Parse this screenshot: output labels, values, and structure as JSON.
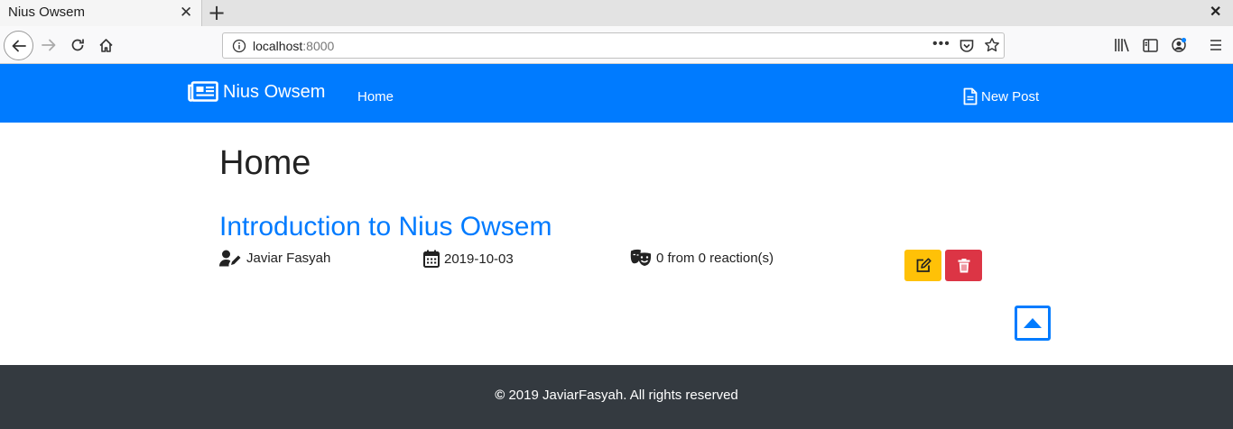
{
  "browser": {
    "tab_title": "Nius Owsem",
    "tab_close": "✕",
    "new_tab": "+",
    "window_close": "✕",
    "url_host": "localhost",
    "url_port": ":8000",
    "url_more": "•••"
  },
  "site": {
    "brand": "Nius Owsem",
    "nav_home": "Home",
    "new_post": "New Post",
    "accent": "#007bff"
  },
  "main": {
    "title": "Home",
    "posts": [
      {
        "title": "Introduction to Nius Owsem",
        "author": "Javiar Fasyah",
        "date": "2019-10-03",
        "reactions": "0 from 0 reaction(s)"
      }
    ]
  },
  "footer": {
    "copyright_symbol": "©",
    "text": "2019 JaviarFasyah. All rights reserved"
  },
  "icons": [
    "back-icon",
    "forward-icon",
    "reload-icon",
    "home-icon",
    "info-icon",
    "pocket-icon",
    "star-icon",
    "library-icon",
    "sidebar-icon",
    "account-icon",
    "menu-icon",
    "newspaper-icon",
    "file-icon",
    "user-edit-icon",
    "calendar-icon",
    "theater-masks-icon",
    "edit-icon",
    "trash-icon",
    "caret-up-icon"
  ]
}
